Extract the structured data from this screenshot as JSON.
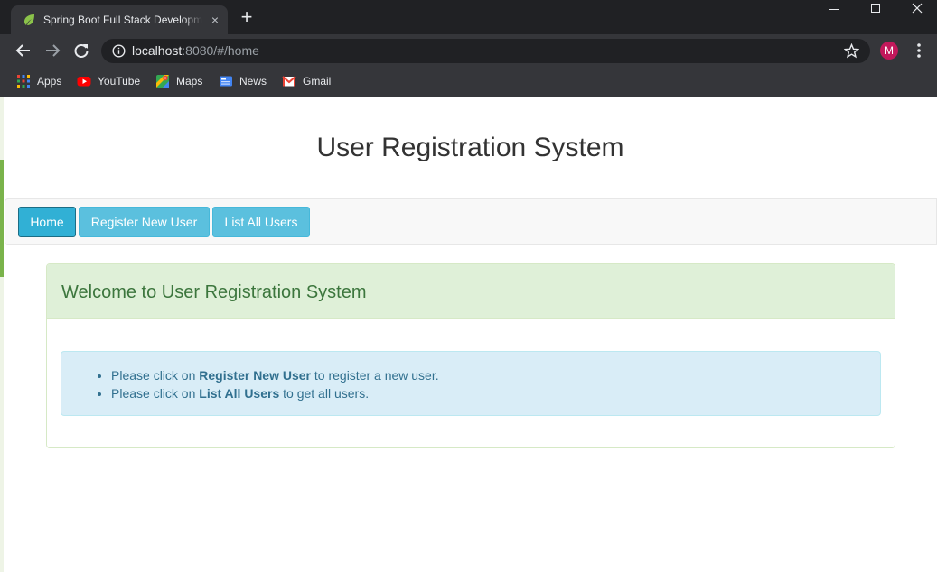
{
  "browser": {
    "tab_title": "Spring Boot Full Stack Development",
    "tab_close": "×",
    "new_tab": "+",
    "url_host": "localhost",
    "url_rest": ":8080/#/home",
    "profile_initial": "M",
    "bookmarks": [
      {
        "label": "Apps",
        "icon": "apps-grid-icon"
      },
      {
        "label": "YouTube",
        "icon": "youtube-icon"
      },
      {
        "label": "Maps",
        "icon": "maps-icon"
      },
      {
        "label": "News",
        "icon": "news-icon"
      },
      {
        "label": "Gmail",
        "icon": "gmail-icon"
      }
    ]
  },
  "page": {
    "title": "User Registration System",
    "nav": {
      "buttons": [
        {
          "label": "Home",
          "active": true
        },
        {
          "label": "Register New User",
          "active": false
        },
        {
          "label": "List All Users",
          "active": false
        }
      ]
    },
    "panel": {
      "heading": "Welcome to User Registration System",
      "items": [
        {
          "prefix": "Please click on ",
          "emphasis": "Register New User",
          "suffix": " to register a new user."
        },
        {
          "prefix": "Please click on ",
          "emphasis": "List All Users",
          "suffix": " to get all users."
        }
      ]
    }
  },
  "colors": {
    "chrome_dark": "#202124",
    "chrome_toolbar": "#35363a",
    "info_button": "#5bc0de",
    "info_button_active": "#31b0d5",
    "success_heading_bg": "#dff0d8",
    "success_text": "#3c763d",
    "info_alert_bg": "#d9edf7",
    "info_alert_text": "#31708f"
  }
}
